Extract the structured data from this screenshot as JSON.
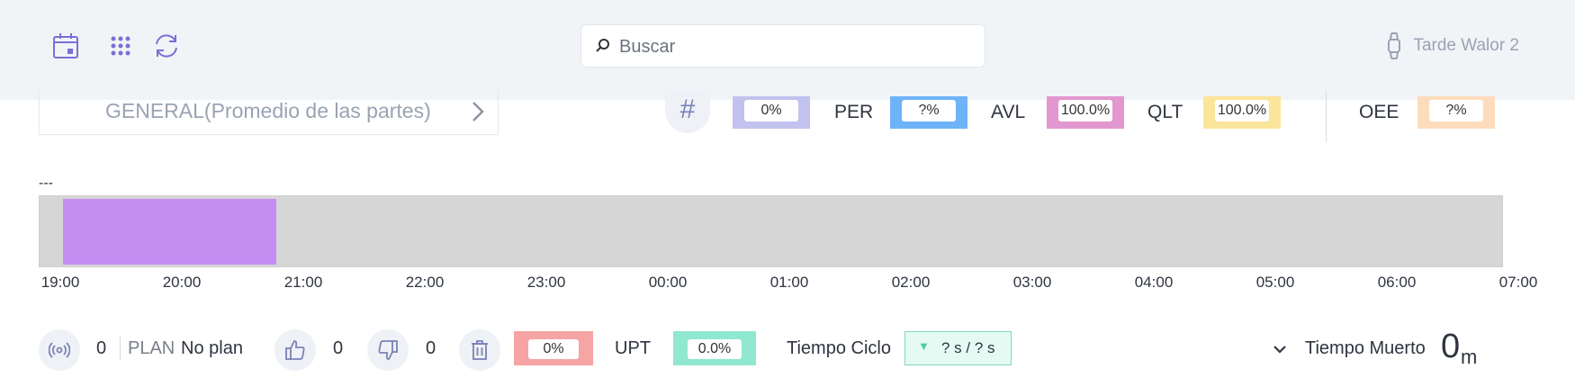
{
  "header": {
    "icons": [
      "calendar-icon",
      "grid-icon",
      "refresh-icon"
    ],
    "search": {
      "placeholder": "Buscar",
      "value": ""
    },
    "user": {
      "name": "Tarde Walor 2",
      "icon": "watch-icon"
    }
  },
  "part_selector": {
    "label": "GENERAL(Promedio de las partes)"
  },
  "kpis": {
    "count": {
      "value": "0%",
      "color": "#c2c2ee"
    },
    "per": {
      "label": "PER",
      "value": "?%",
      "color": "#6eb3f7"
    },
    "avl": {
      "label": "AVL",
      "value": "100.0%",
      "color": "#e397cf"
    },
    "qlt": {
      "label": "QLT",
      "value": "100.0%",
      "color": "#fbe59b"
    },
    "oee": {
      "label": "OEE",
      "value": "?%",
      "color": "#fddcbd"
    }
  },
  "timeline": {
    "caption": "---",
    "ticks": [
      "19:00",
      "20:00",
      "21:00",
      "22:00",
      "23:00",
      "00:00",
      "01:00",
      "02:00",
      "03:00",
      "04:00",
      "05:00",
      "06:00",
      "07:00"
    ],
    "segment": {
      "start": "19:00",
      "end": "20:46",
      "color": "#c48df2"
    }
  },
  "bottom": {
    "signal_count": "0",
    "plan_label": "PLAN",
    "plan_value": "No plan",
    "good_count": "0",
    "bad_count": "0",
    "scrap_pct": "0%",
    "upt_label": "UPT",
    "upt_value": "0.0%",
    "cycle_label": "Tiempo Ciclo",
    "cycle_value": "? s / ? s",
    "dead_label": "Tiempo Muerto",
    "dead_value": "0",
    "dead_unit": "m"
  },
  "colors": {
    "accent": "#7a6fd6",
    "scrap": "#f6a4a4",
    "upt": "#8fe8cf",
    "cycle_border": "#7fd8c0",
    "cycle_arrow": "#4ecba8"
  }
}
